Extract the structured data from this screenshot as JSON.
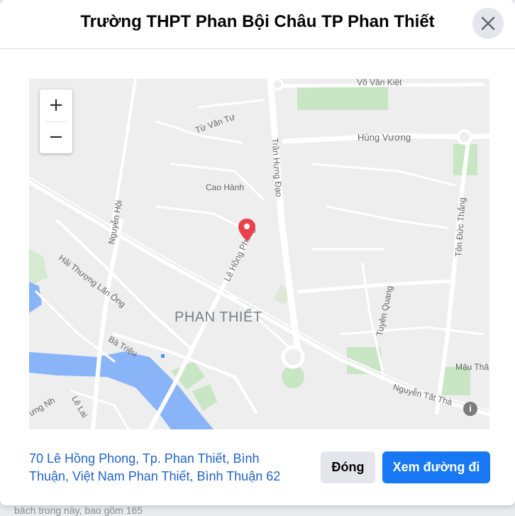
{
  "dialog": {
    "title": "Trường THPT Phan Bội Châu TP Phan Thiết",
    "close_icon": "close-icon"
  },
  "map": {
    "zoom_in_icon": "plus-icon",
    "zoom_out_icon": "minus-icon",
    "city_label": "PHAN THIẾT",
    "streets": {
      "vo_van_kiet": "Võ Văn Kiệt",
      "tu_van_tu": "Từ Văn Tư",
      "hung_vuong": "Hùng Vương",
      "tran_hung_dao": "Trần Hưng Đạo",
      "cao_hanh": "Cao Hành",
      "nguyen_hoi": "Nguyễn Hội",
      "le_hong_phong": "Lê Hồng Phong",
      "ton_duc_thang": "Tôn Đức Thắng",
      "hai_thuong_lan_ong": "Hải Thượng Lãn Ông",
      "tuyen_quang": "Tuyên Quang",
      "ba_trieu": "Bà Triệu",
      "mau_than": "Mậu Thâ",
      "nguyen_tat_thanh": "Nguyễn Tất Thà",
      "trung_nh": "ưng Nh",
      "le_lai": "Lê Lai"
    },
    "marker_icon": "map-pin-icon",
    "info_icon": "info-icon",
    "colors": {
      "marker": "#e8414b",
      "water": "#8ab4f8",
      "park": "#c8e6c4"
    }
  },
  "footer": {
    "address": "70 Lê Hồng Phong, Tp. Phan Thiết, Bình Thuận, Việt Nam Phan Thiết, Bình Thuận 62",
    "close_label": "Đóng",
    "directions_label": "Xem đường đi"
  },
  "background": {
    "partial_text": "bách trong này, bao gồm 165"
  }
}
